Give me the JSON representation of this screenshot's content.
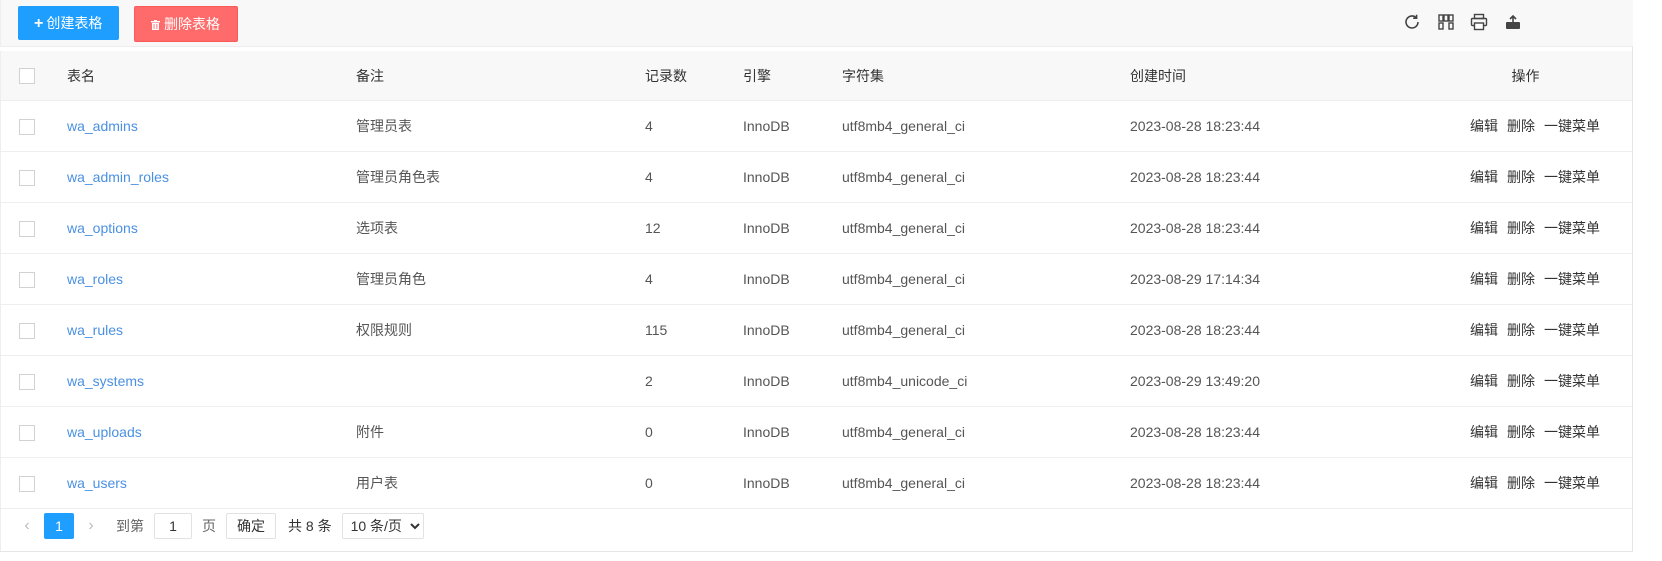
{
  "toolbar": {
    "create_label": "创建表格",
    "delete_label": "删除表格",
    "icons": [
      "refresh-icon",
      "columns-icon",
      "print-icon",
      "export-icon"
    ]
  },
  "table": {
    "headers": {
      "name": "表名",
      "note": "备注",
      "count": "记录数",
      "engine": "引擎",
      "charset": "字符集",
      "created": "创建时间",
      "ops": "操作"
    },
    "rows": [
      {
        "name": "wa_admins",
        "note": "管理员表",
        "count": "4",
        "engine": "InnoDB",
        "charset": "utf8mb4_general_ci",
        "created": "2023-08-28 18:23:44"
      },
      {
        "name": "wa_admin_roles",
        "note": "管理员角色表",
        "count": "4",
        "engine": "InnoDB",
        "charset": "utf8mb4_general_ci",
        "created": "2023-08-28 18:23:44"
      },
      {
        "name": "wa_options",
        "note": "选项表",
        "count": "12",
        "engine": "InnoDB",
        "charset": "utf8mb4_general_ci",
        "created": "2023-08-28 18:23:44"
      },
      {
        "name": "wa_roles",
        "note": "管理员角色",
        "count": "4",
        "engine": "InnoDB",
        "charset": "utf8mb4_general_ci",
        "created": "2023-08-29 17:14:34"
      },
      {
        "name": "wa_rules",
        "note": "权限规则",
        "count": "115",
        "engine": "InnoDB",
        "charset": "utf8mb4_general_ci",
        "created": "2023-08-28 18:23:44"
      },
      {
        "name": "wa_systems",
        "note": "",
        "count": "2",
        "engine": "InnoDB",
        "charset": "utf8mb4_unicode_ci",
        "created": "2023-08-29 13:49:20"
      },
      {
        "name": "wa_uploads",
        "note": "附件",
        "count": "0",
        "engine": "InnoDB",
        "charset": "utf8mb4_general_ci",
        "created": "2023-08-28 18:23:44"
      },
      {
        "name": "wa_users",
        "note": "用户表",
        "count": "0",
        "engine": "InnoDB",
        "charset": "utf8mb4_general_ci",
        "created": "2023-08-28 18:23:44"
      }
    ],
    "ops": {
      "edit": "编辑",
      "delete": "删除",
      "menu": "一键菜单"
    }
  },
  "pager": {
    "prev": "‹",
    "current": "1",
    "next": "›",
    "goto_label": "到第",
    "goto_value": "1",
    "page_label": "页",
    "confirm_label": "确定",
    "total": "共 8 条",
    "page_size": "10 条/页"
  },
  "colors": {
    "primary": "#1e9fff",
    "danger": "#ff6b6b",
    "link": "#4a90e2"
  }
}
